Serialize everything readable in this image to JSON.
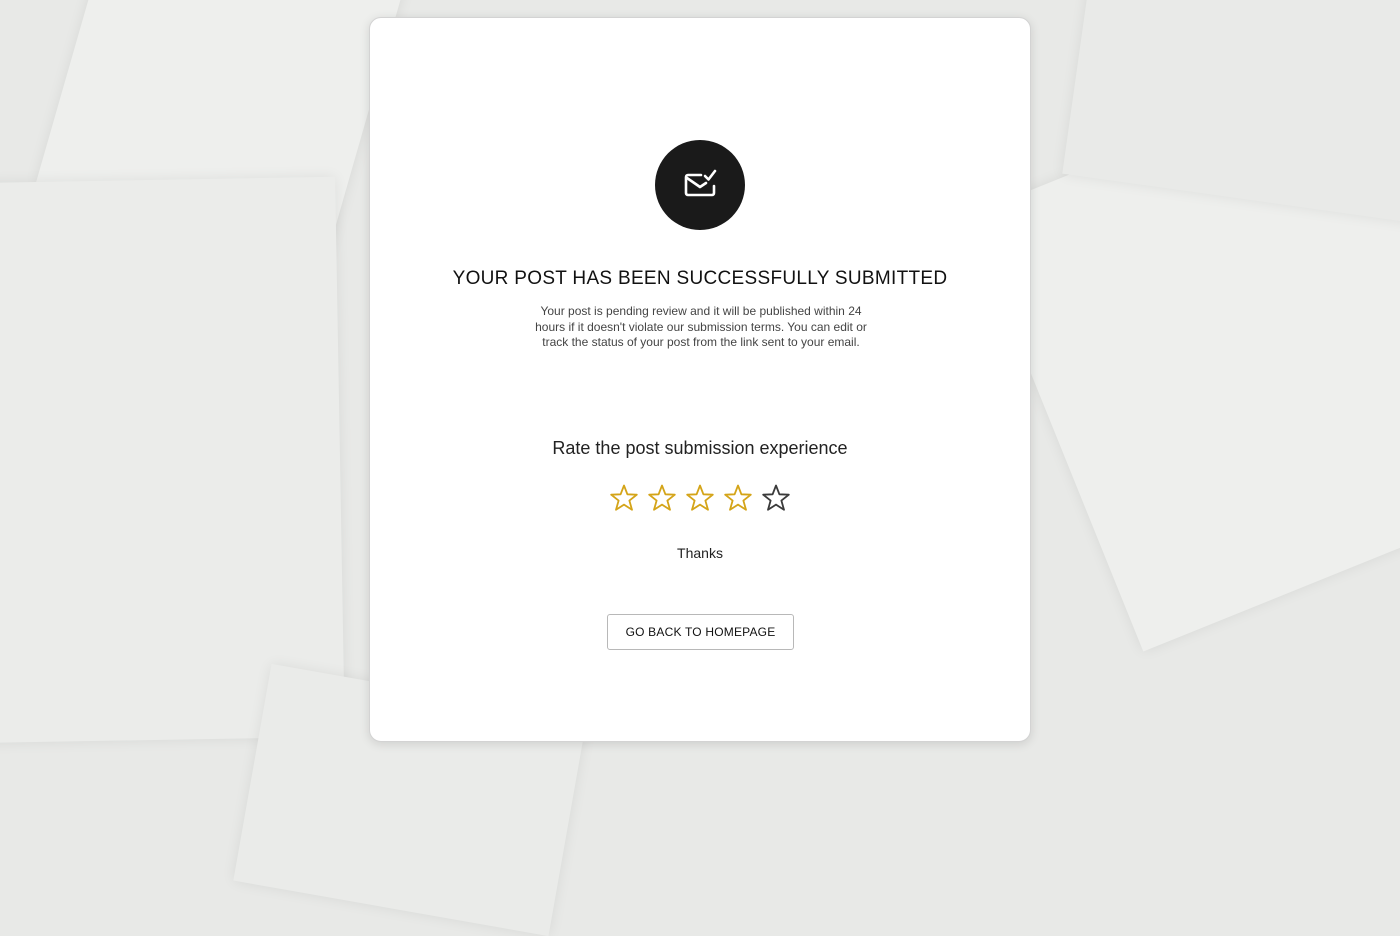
{
  "confirmation": {
    "icon": "mail-check-icon",
    "title": "YOUR POST HAS BEEN SUCCESSFULLY SUBMITTED",
    "description": "Your post is pending review and it will be published within 24 hours if it doesn't violate our submission terms. You can edit or track the status of your post from the link sent to your email."
  },
  "rating": {
    "label": "Rate the post submission experience",
    "max_stars": 5,
    "selected": 4,
    "active_color": "#d4a418",
    "inactive_color": "#3a3a3a",
    "thanks_text": "Thanks"
  },
  "actions": {
    "home_button_label": "GO BACK TO HOMEPAGE"
  }
}
